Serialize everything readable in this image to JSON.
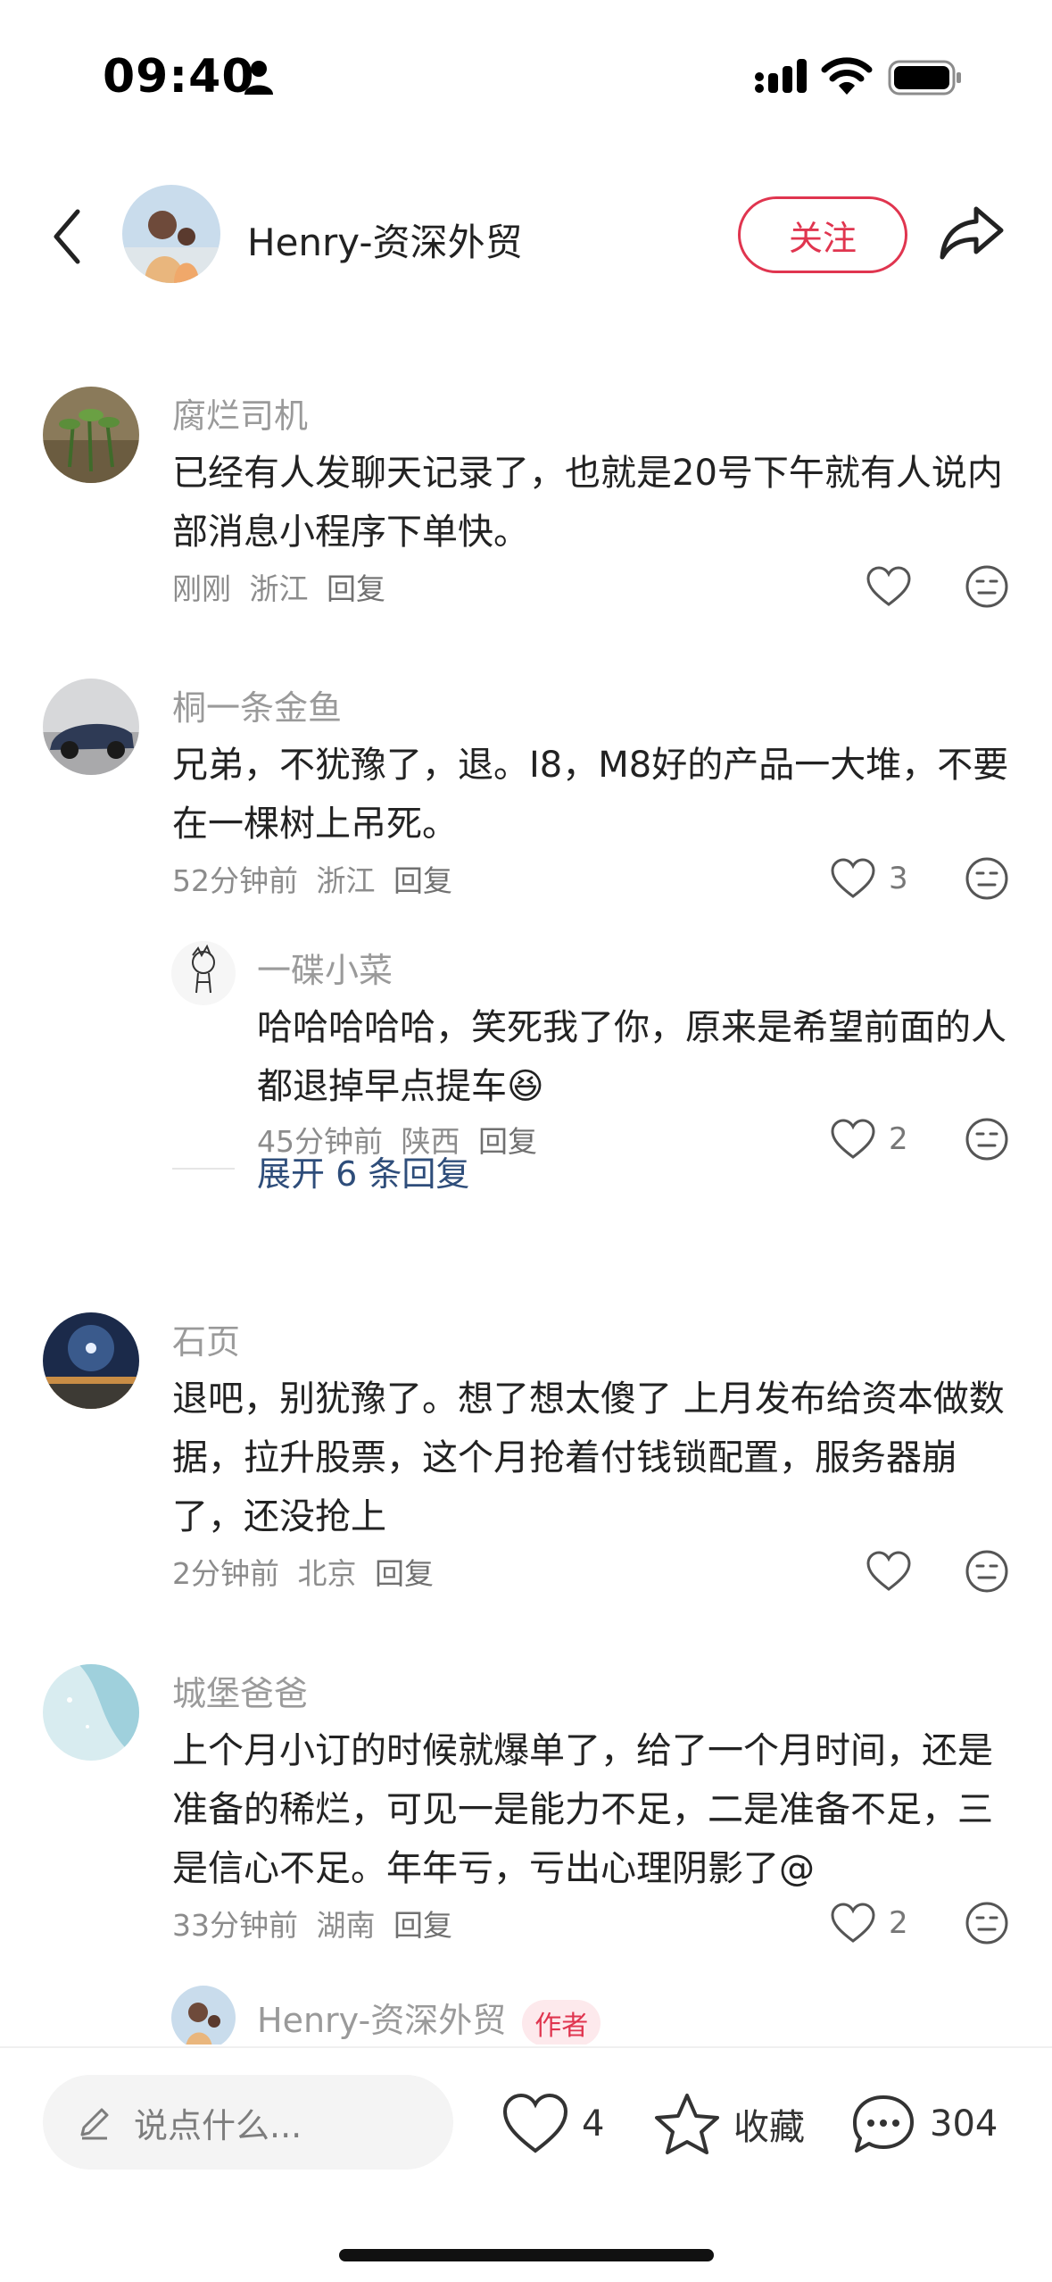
{
  "status_bar": {
    "time": "09:40",
    "icons": [
      "person-icon",
      "signal-icon",
      "wifi-icon",
      "battery-icon"
    ]
  },
  "header": {
    "author_name": "Henry-资深外贸",
    "follow_label": "关注",
    "icons": [
      "back-icon",
      "share-icon"
    ]
  },
  "comments": [
    {
      "name": "腐烂司机",
      "text": "已经有人发聊天记录了，也就是20号下午就有人说内部消息小程序下单快。",
      "time": "刚刚",
      "location": "浙江",
      "reply": "回复",
      "likes": ""
    },
    {
      "name": "桐一条金鱼",
      "text": "兄弟，不犹豫了，退。I8，M8好的产品一大堆，不要在一棵树上吊死。",
      "time": "52分钟前",
      "location": "浙江",
      "reply": "回复",
      "likes": "3",
      "sub": {
        "name": "一碟小菜",
        "text": "哈哈哈哈哈，笑死我了你，原来是希望前面的人都退掉早点提车",
        "emoji": "😆",
        "time": "45分钟前",
        "location": "陕西",
        "reply": "回复",
        "likes": "2"
      },
      "expand": "展开 6 条回复"
    },
    {
      "name": "石页",
      "text": "退吧，别犹豫了。想了想太傻了 上月发布给资本做数据，拉升股票，这个月抢着付钱锁配置，服务器崩了，还没抢上",
      "time": "2分钟前",
      "location": "北京",
      "reply": "回复",
      "likes": ""
    },
    {
      "name": "城堡爸爸",
      "text": "上个月小订的时候就爆单了，给了一个月时间，还是准备的稀烂，可见一是能力不足，二是准备不足，三是信心不足。年年亏，亏出心理阴影了@",
      "time": "33分钟前",
      "location": "湖南",
      "reply": "回复",
      "likes": "2",
      "sub": {
        "name": "Henry-资深外贸",
        "tag": "作者"
      }
    }
  ],
  "bottom_bar": {
    "placeholder": "说点什么...",
    "likes": "4",
    "collect_label": "收藏",
    "comment_count": "304"
  },
  "colors": {
    "accent": "#e0354f",
    "link": "#2e4d7a",
    "muted": "#9a9a9a"
  }
}
